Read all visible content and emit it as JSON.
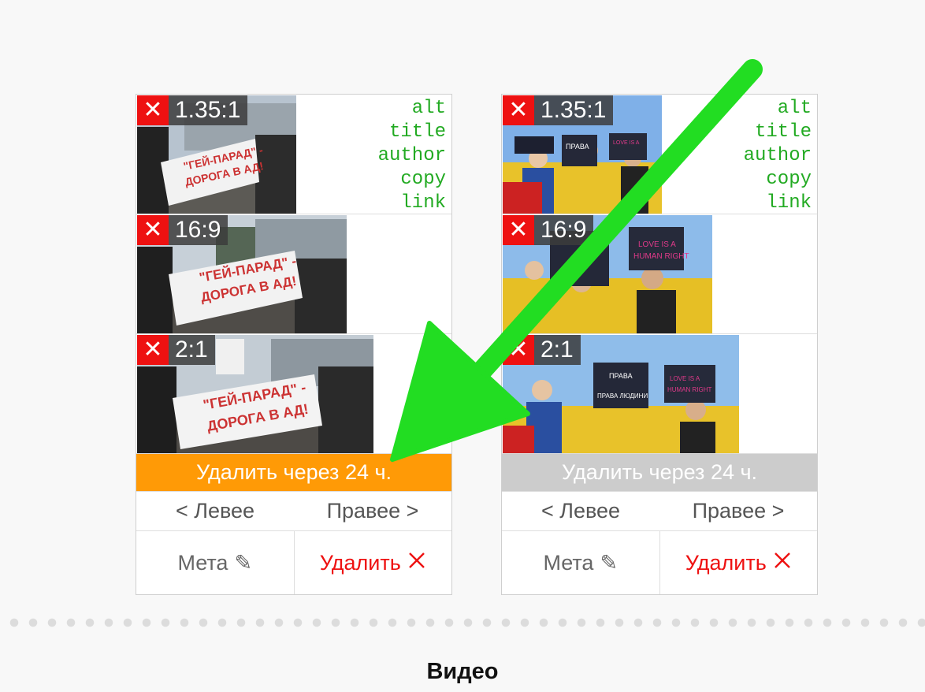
{
  "cards": [
    {
      "crops": [
        {
          "ratio": "1.35:1",
          "remove_glyph": "✕"
        },
        {
          "ratio": "16:9",
          "remove_glyph": "✕"
        },
        {
          "ratio": "2:1",
          "remove_glyph": "✕"
        }
      ],
      "meta_fields": [
        "alt",
        "title",
        "author",
        "copy",
        "link"
      ],
      "delete_timer": "Удалить через 24 ч.",
      "timer_active": true,
      "nav_left": "< Левее",
      "nav_right": "Правее >",
      "meta_button": "Мета",
      "delete_button": "Удалить",
      "banner": {
        "line1": "\"ГЕЙ-ПАРАД\" -",
        "line2": "ДОРОГА В АД!"
      }
    },
    {
      "crops": [
        {
          "ratio": "1.35:1",
          "remove_glyph": "✕"
        },
        {
          "ratio": "16:9",
          "remove_glyph": "✕"
        },
        {
          "ratio": "2:1",
          "remove_glyph": "✕"
        }
      ],
      "meta_fields": [
        "alt",
        "title",
        "author",
        "copy",
        "link"
      ],
      "delete_timer": "Удалить через 24 ч.",
      "timer_active": false,
      "nav_left": "< Левее",
      "nav_right": "Правее >",
      "meta_button": "Мета",
      "delete_button": "Удалить",
      "signs": {
        "a_line1": "ПРАВА",
        "a_line2": "ПРАВА ЛЮДИНИ",
        "b_line1": "LOVE IS A",
        "b_line2": "HUMAN RIGHT"
      }
    }
  ],
  "icons": {
    "pencil": "pencil-icon",
    "close": "close-icon"
  },
  "colors": {
    "accent_orange": "#ff9a06",
    "disabled_gray": "#cccccc",
    "danger_red": "#ee1111",
    "meta_green": "#22aa22",
    "arrow_green": "#22dd22"
  },
  "section_title": "Видео"
}
